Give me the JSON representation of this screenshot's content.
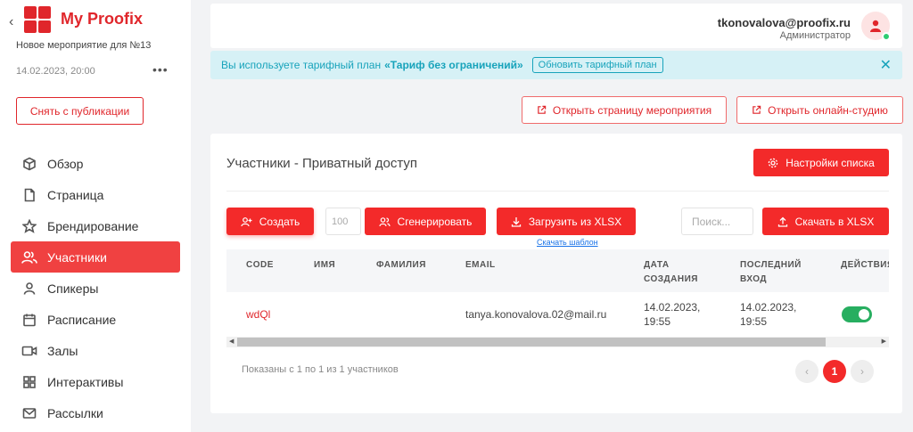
{
  "sidebar": {
    "brand": "My Proofix",
    "event_name": "Новое мероприятие для №13",
    "event_date": "14.02.2023, 20:00",
    "more_label": "•••",
    "unpublish_label": "Снять с публикации",
    "items": [
      {
        "label": "Обзор",
        "icon": "cube-icon"
      },
      {
        "label": "Страница",
        "icon": "file-icon"
      },
      {
        "label": "Брендирование",
        "icon": "star-icon"
      },
      {
        "label": "Участники",
        "icon": "users-icon",
        "active": true
      },
      {
        "label": "Спикеры",
        "icon": "user-icon"
      },
      {
        "label": "Расписание",
        "icon": "calendar-icon"
      },
      {
        "label": "Залы",
        "icon": "video-icon"
      },
      {
        "label": "Интерактивы",
        "icon": "grid-icon"
      },
      {
        "label": "Рассылки",
        "icon": "mail-icon"
      }
    ]
  },
  "header": {
    "user_email": "tkonovalova@proofix.ru",
    "user_role": "Администратор"
  },
  "banner": {
    "text": "Вы используете тарифный план",
    "plan": "«Тариф без ограничений»",
    "upgrade_label": "Обновить тарифный план",
    "close": "✕"
  },
  "actions": {
    "open_event_page": "Открыть страницу мероприятия",
    "open_studio": "Открыть онлайн-студию"
  },
  "participants": {
    "title": "Участники - Приватный доступ",
    "settings_label": "Настройки списка",
    "create_label": "Создать",
    "count_value": "100",
    "generate_label": "Сгенерировать",
    "upload_label": "Загрузить из XLSX",
    "template_link": "Скачать шаблон",
    "search_placeholder": "Поиск...",
    "download_label": "Скачать в XLSX",
    "columns": {
      "code": "CODE",
      "name": "ИМЯ",
      "surname": "ФАМИЛИЯ",
      "email": "EMAIL",
      "created_1": "ДАТА",
      "created_2": "СОЗДАНИЯ",
      "last_1": "ПОСЛЕДНИЙ",
      "last_2": "ВХОД",
      "actions": "ДЕЙСТВИЯ"
    },
    "rows": [
      {
        "code": "wdQl",
        "name": "",
        "surname": "",
        "email": "tanya.konovalova.02@mail.ru",
        "created_date": "14.02.2023,",
        "created_time": "19:55",
        "last_date": "14.02.2023,",
        "last_time": "19:55",
        "enabled": true
      }
    ],
    "footer_text": "Показаны с 1 по 1 из 1 участников",
    "pagination": {
      "prev": "‹",
      "current": "1",
      "next": "›"
    }
  },
  "colors": {
    "accent": "#f32a2a",
    "brand": "#e0262b",
    "info": "#17a3bb",
    "success": "#27ae60"
  }
}
